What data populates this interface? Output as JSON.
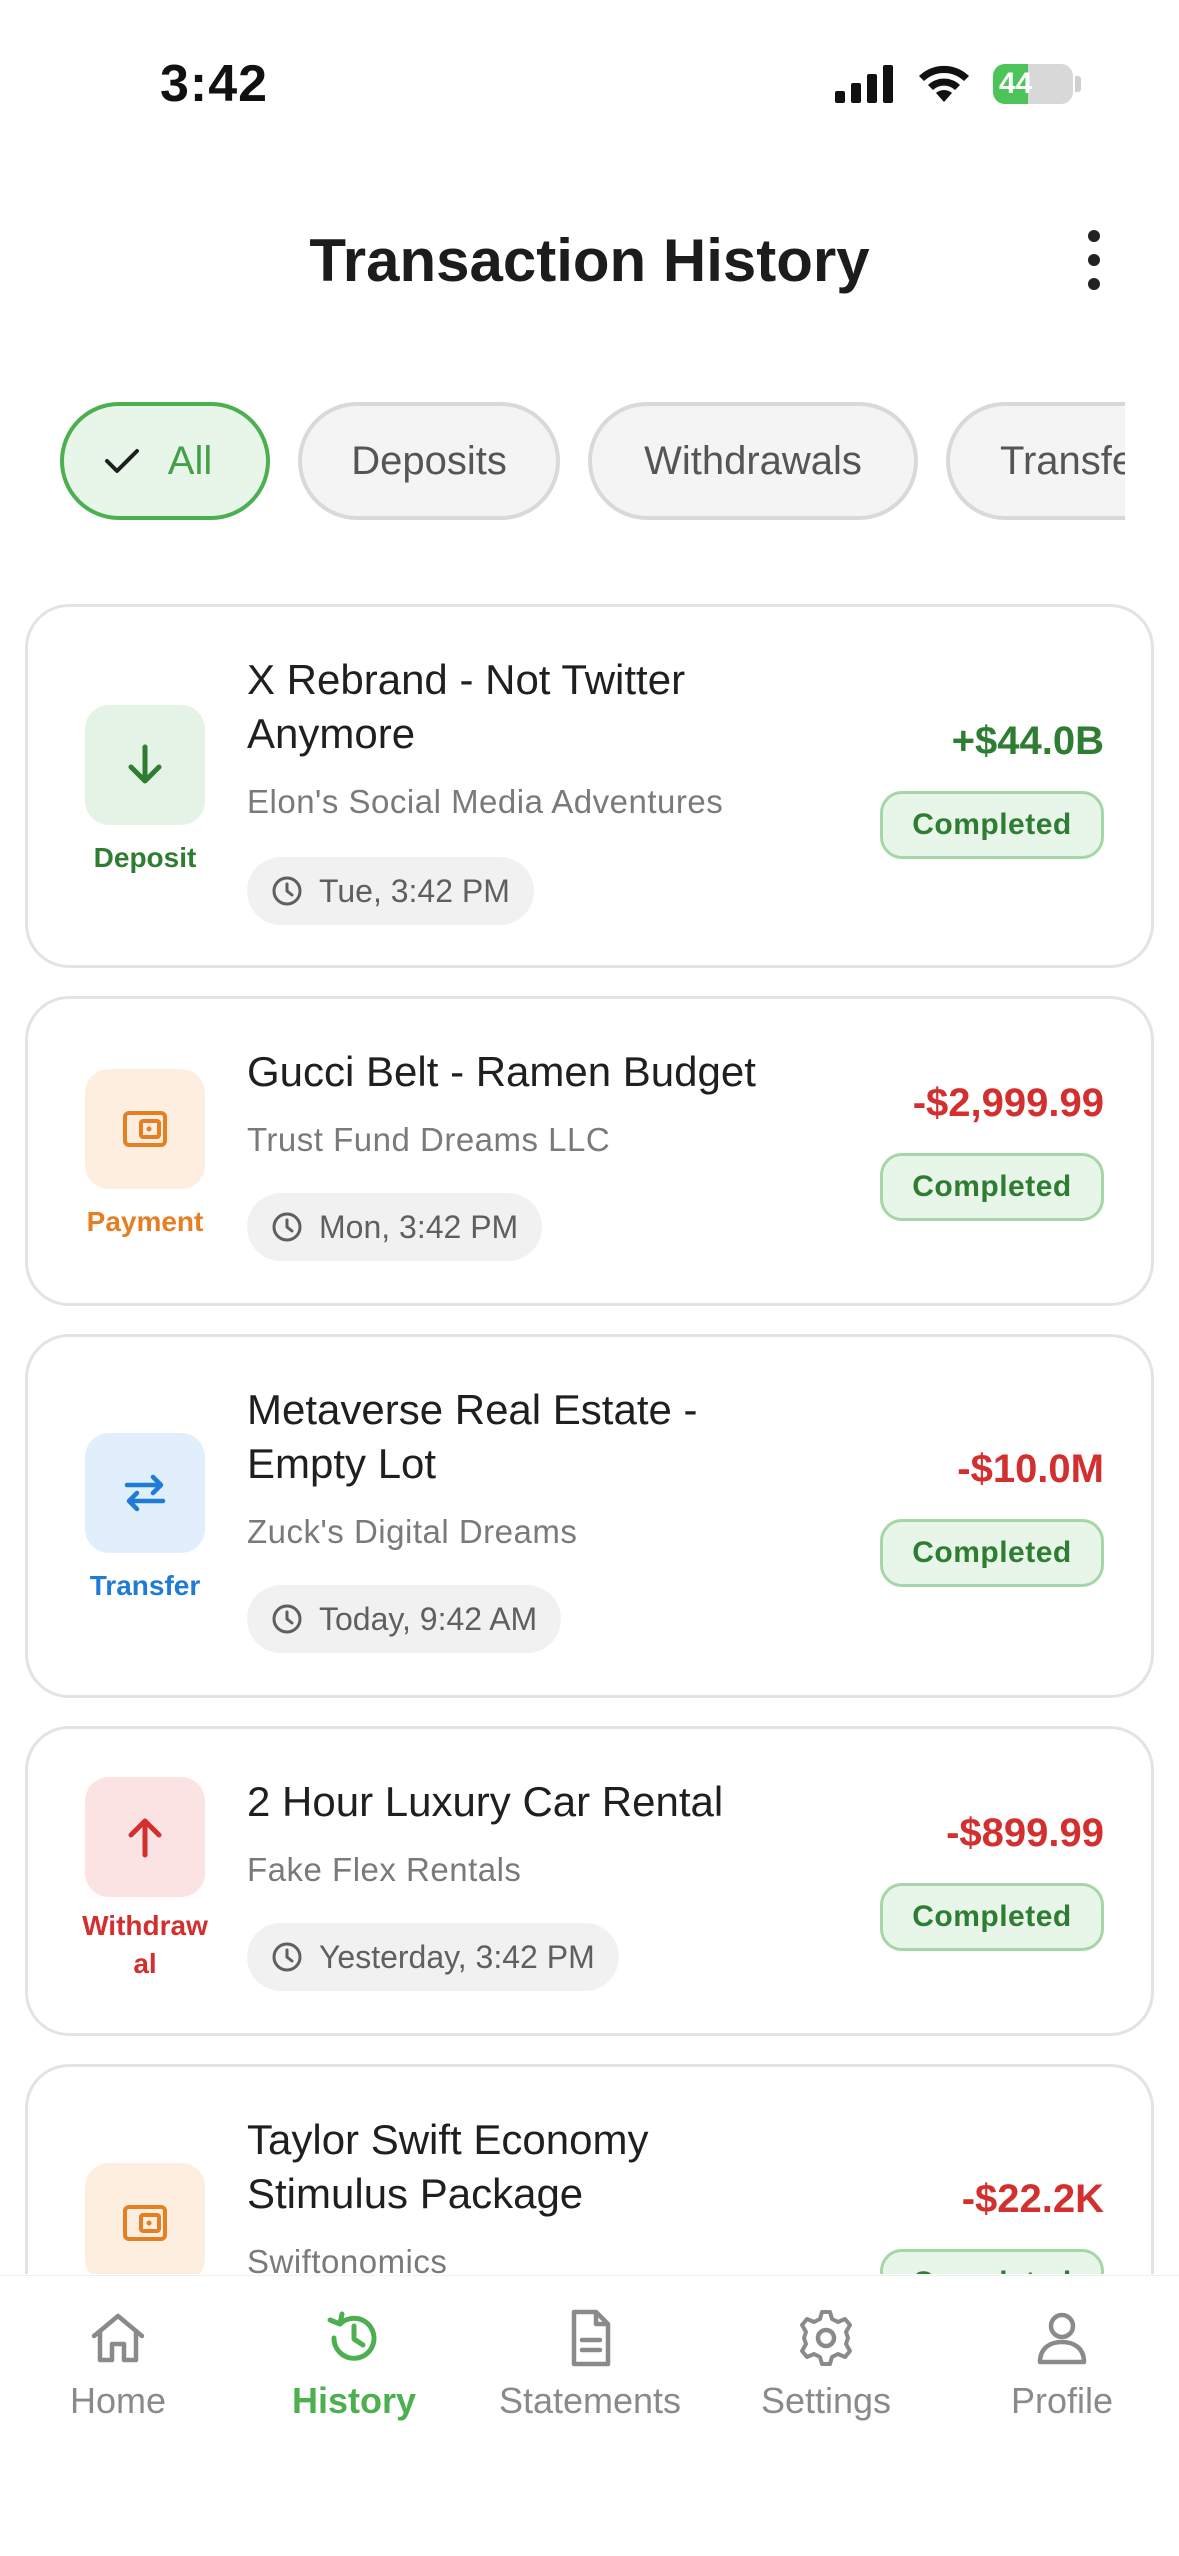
{
  "status_bar": {
    "time": "3:42",
    "battery": "44"
  },
  "header": {
    "title": "Transaction History"
  },
  "filters": [
    {
      "label": "All",
      "active": true
    },
    {
      "label": "Deposits",
      "active": false
    },
    {
      "label": "Withdrawals",
      "active": false
    },
    {
      "label": "Transfers",
      "active": false
    }
  ],
  "transactions": [
    {
      "type": "Deposit",
      "title": "X Rebrand - Not Twitter Anymore",
      "merchant": "Elon's Social Media Adventures",
      "time": "Tue, 3:42 PM",
      "amount": "+$44.0B",
      "status": "Completed"
    },
    {
      "type": "Payment",
      "title": "Gucci Belt - Ramen Budget",
      "merchant": "Trust Fund Dreams LLC",
      "time": "Mon, 3:42 PM",
      "amount": "-$2,999.99",
      "status": "Completed"
    },
    {
      "type": "Transfer",
      "title": "Metaverse Real Estate - Empty Lot",
      "merchant": "Zuck's Digital Dreams",
      "time": "Today, 9:42 AM",
      "amount": "-$10.0M",
      "status": "Completed"
    },
    {
      "type": "Withdraw al",
      "title": "2 Hour Luxury Car Rental",
      "merchant": "Fake Flex Rentals",
      "time": "Yesterday, 3:42 PM",
      "amount": "-$899.99",
      "status": "Completed"
    },
    {
      "type": "Payment",
      "title": "Taylor Swift Economy Stimulus Package",
      "merchant": "Swiftonomics",
      "time": "",
      "amount": "-$22.2K",
      "status": "Completed"
    }
  ],
  "bottom_nav": [
    {
      "label": "Home",
      "icon": "home-icon",
      "active": false
    },
    {
      "label": "History",
      "icon": "history-icon",
      "active": true
    },
    {
      "label": "Statements",
      "icon": "document-icon",
      "active": false
    },
    {
      "label": "Settings",
      "icon": "gear-icon",
      "active": false
    },
    {
      "label": "Profile",
      "icon": "person-icon",
      "active": false
    }
  ],
  "colors": {
    "accent": "#4caf50",
    "deposit": "#2e7d32",
    "payment": "#e67e22",
    "transfer": "#1e7bd6",
    "withdrawal": "#d32f2f",
    "negative_amount": "#d32f2f",
    "positive_amount": "#2e7d32"
  }
}
